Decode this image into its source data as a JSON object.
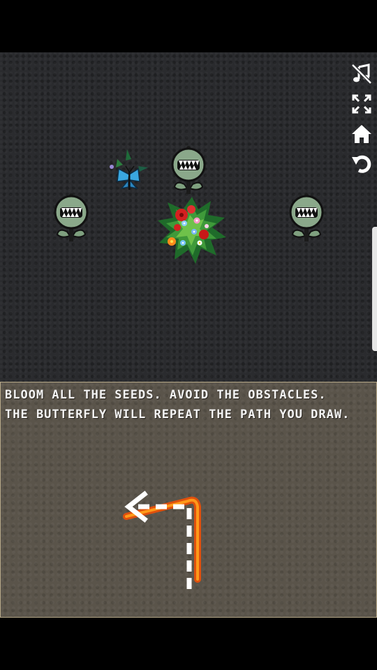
{
  "game": {
    "instructions": {
      "line1": "BLOOM ALL THE SEEDS. AVOID THE OBSTACLES.",
      "line2": "THE BUTTERFLY WILL REPEAT THE PATH YOU DRAW."
    },
    "toolbar": {
      "icons": [
        "music-muted-icon",
        "fullscreen-icon",
        "home-icon",
        "restart-icon"
      ]
    },
    "sprites": [
      "butterfly",
      "venus-flytrap-monster",
      "flower-bush"
    ],
    "colors": {
      "playfield": "#2a2b2e",
      "panel": "#5a544a",
      "monster": "#8aa88a",
      "butterfly": "#3aa7e0",
      "drawn_path": "#ff6a00",
      "guide_path": "#ffffff"
    }
  }
}
